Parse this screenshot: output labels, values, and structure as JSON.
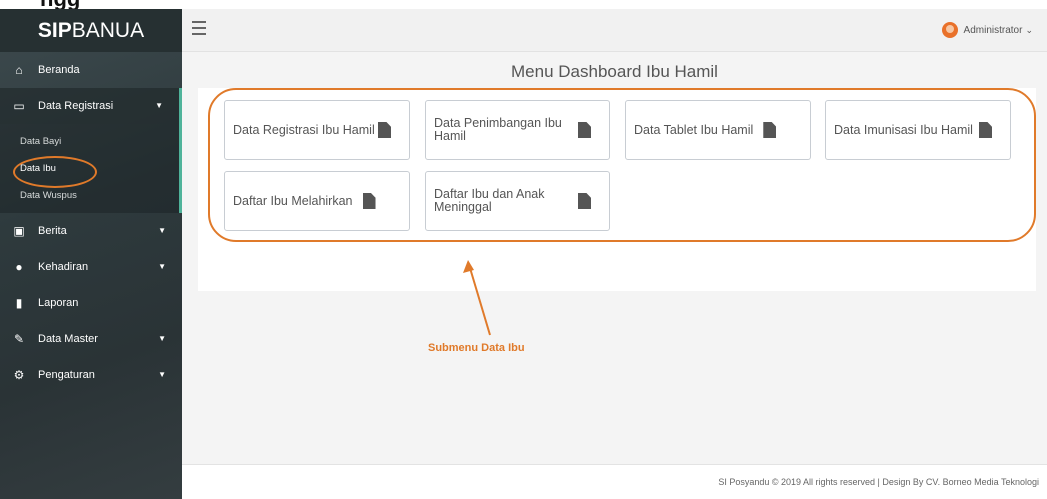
{
  "brand": {
    "bold": "SIP",
    "rest": "BANUA"
  },
  "header": {
    "user": "Administrator",
    "user_chevron": "⌄"
  },
  "sidebar": {
    "items": [
      {
        "icon": "home-icon",
        "label": "Beranda"
      },
      {
        "icon": "monitor-icon",
        "label": "Data Registrasi"
      },
      {
        "icon": "newspaper-icon",
        "label": "Berita"
      },
      {
        "icon": "users-icon",
        "label": "Kehadiran"
      },
      {
        "icon": "file-icon",
        "label": "Laporan"
      },
      {
        "icon": "edit-icon",
        "label": "Data Master"
      },
      {
        "icon": "gear-icon",
        "label": "Pengaturan"
      }
    ],
    "sub": [
      "Data Bayi",
      "Data Ibu",
      "Data Wuspus"
    ]
  },
  "main": {
    "title": "Menu Dashboard Ibu Hamil",
    "cards": [
      "Data Registrasi Ibu Hamil",
      "Data Penimbangan Ibu Hamil",
      "Data Tablet Ibu Hamil",
      "Data Imunisasi Ibu Hamil",
      "Daftar Ibu Melahirkan",
      "Daftar Ibu dan Anak Meninggal"
    ]
  },
  "annotation": "Submenu Data Ibu",
  "footer": "SI Posyandu © 2019 All rights reserved | Design By CV. Borneo Media Teknologi",
  "colors": {
    "accent": "#e07a2a",
    "active_bar": "#4fb39a"
  }
}
